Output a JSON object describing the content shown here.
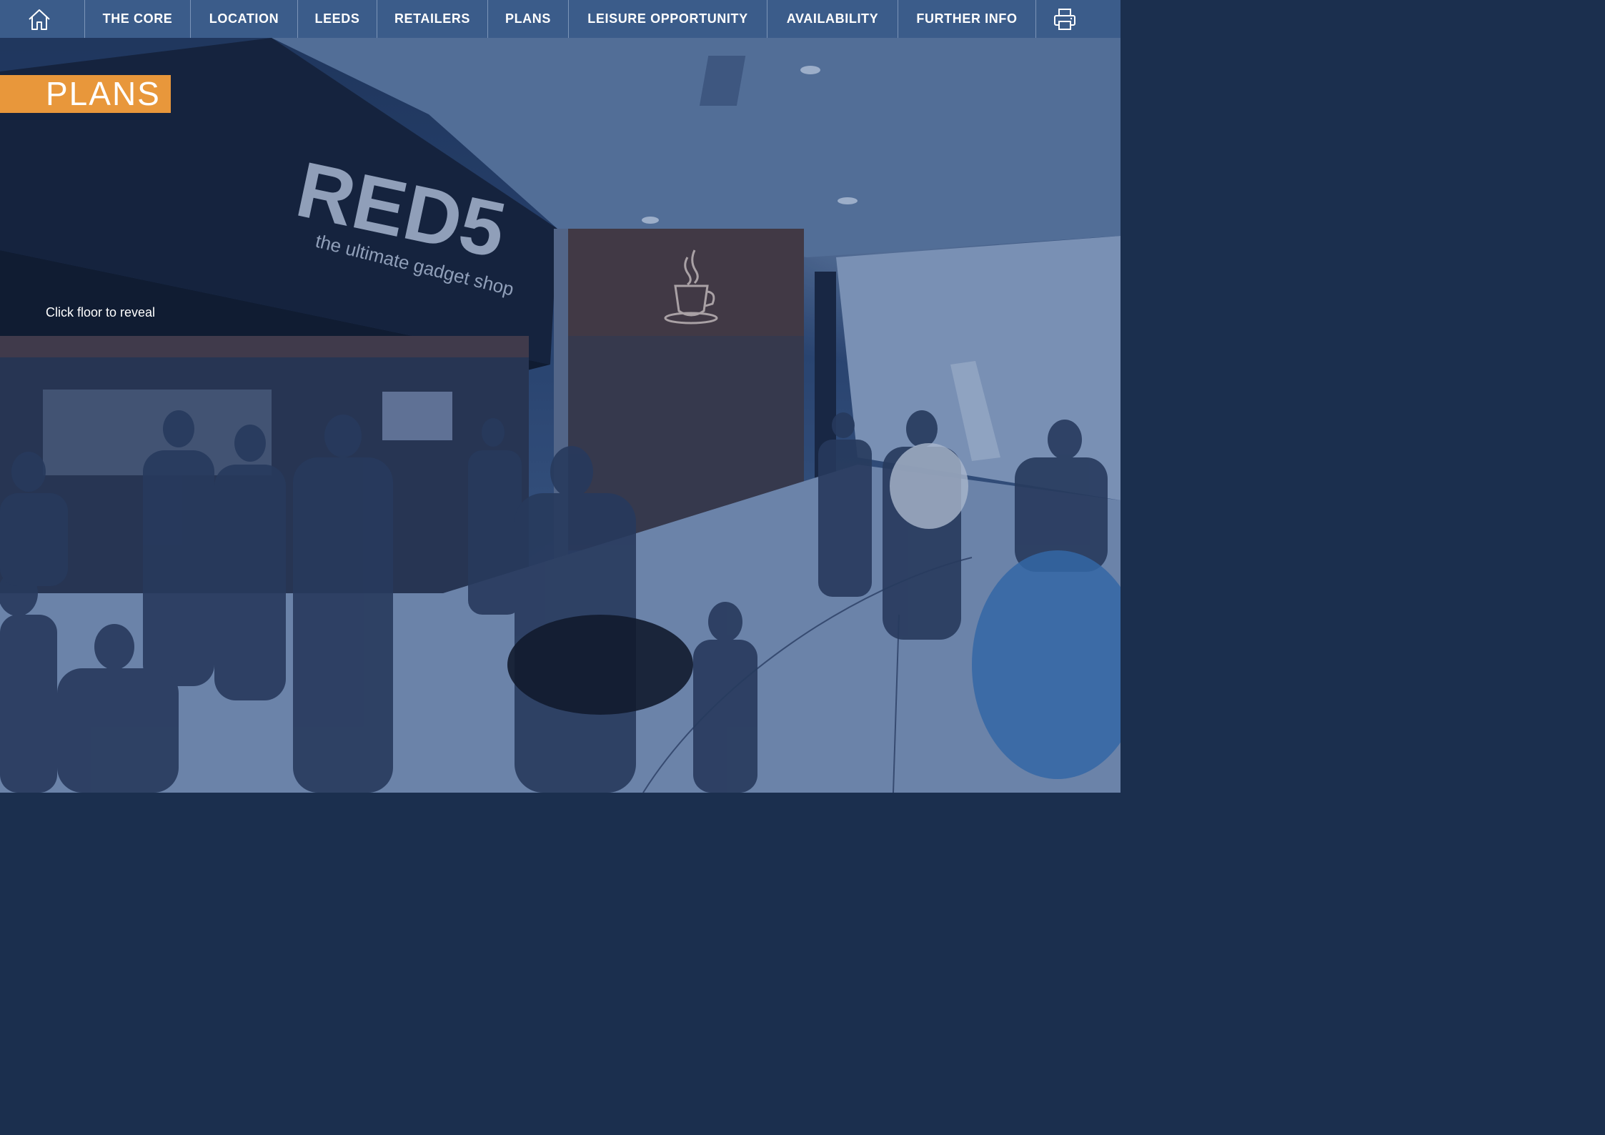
{
  "nav": {
    "home_icon": "home-icon",
    "items": [
      {
        "label": "THE CORE"
      },
      {
        "label": "LOCATION"
      },
      {
        "label": "LEEDS"
      },
      {
        "label": "RETAILERS"
      },
      {
        "label": "PLANS"
      },
      {
        "label": "LEISURE OPPORTUNITY"
      },
      {
        "label": "AVAILABILITY"
      },
      {
        "label": "FURTHER INFO"
      }
    ],
    "print_icon": "printer-icon"
  },
  "page": {
    "title": "PLANS",
    "hint": "Click floor to reveal"
  },
  "background": {
    "store_sign": "RED5",
    "store_tagline": "the ultimate gadget shop"
  },
  "colors": {
    "nav_bg": "#3b5c8a",
    "title_accent": "#e8973b",
    "text": "#ffffff"
  }
}
